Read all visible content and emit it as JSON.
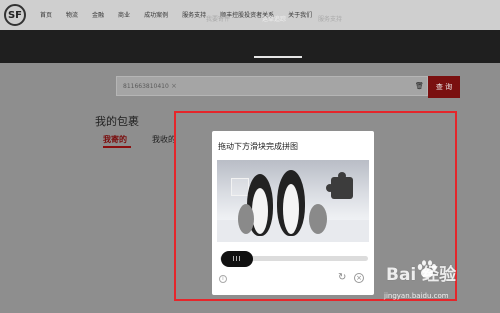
{
  "header": {
    "logo": "SF",
    "nav": [
      "首页",
      "物流",
      "金融",
      "商业",
      "成功案例",
      "服务支持",
      "顺丰控股投资者关系",
      "关于我们"
    ]
  },
  "subnav": {
    "items": [
      "我要寄件",
      "运单追踪",
      "服务支持"
    ],
    "active": "运单追踪"
  },
  "search": {
    "value": "811663810410",
    "clear_glyph": "×",
    "button_label": "查 询"
  },
  "parcels": {
    "title": "我的包裹",
    "tabs": [
      "我寄的",
      "我收的"
    ]
  },
  "captcha": {
    "title": "拖动下方滑块完成拼图",
    "handle_label": "III",
    "icons": [
      "info-icon",
      "refresh-icon",
      "close-icon"
    ]
  },
  "watermark": {
    "brand": "Bai  经验",
    "url": "jingyan.baidu.com"
  },
  "colors": {
    "highlight": "#e5262b",
    "brand_red": "#8b0f0f"
  }
}
